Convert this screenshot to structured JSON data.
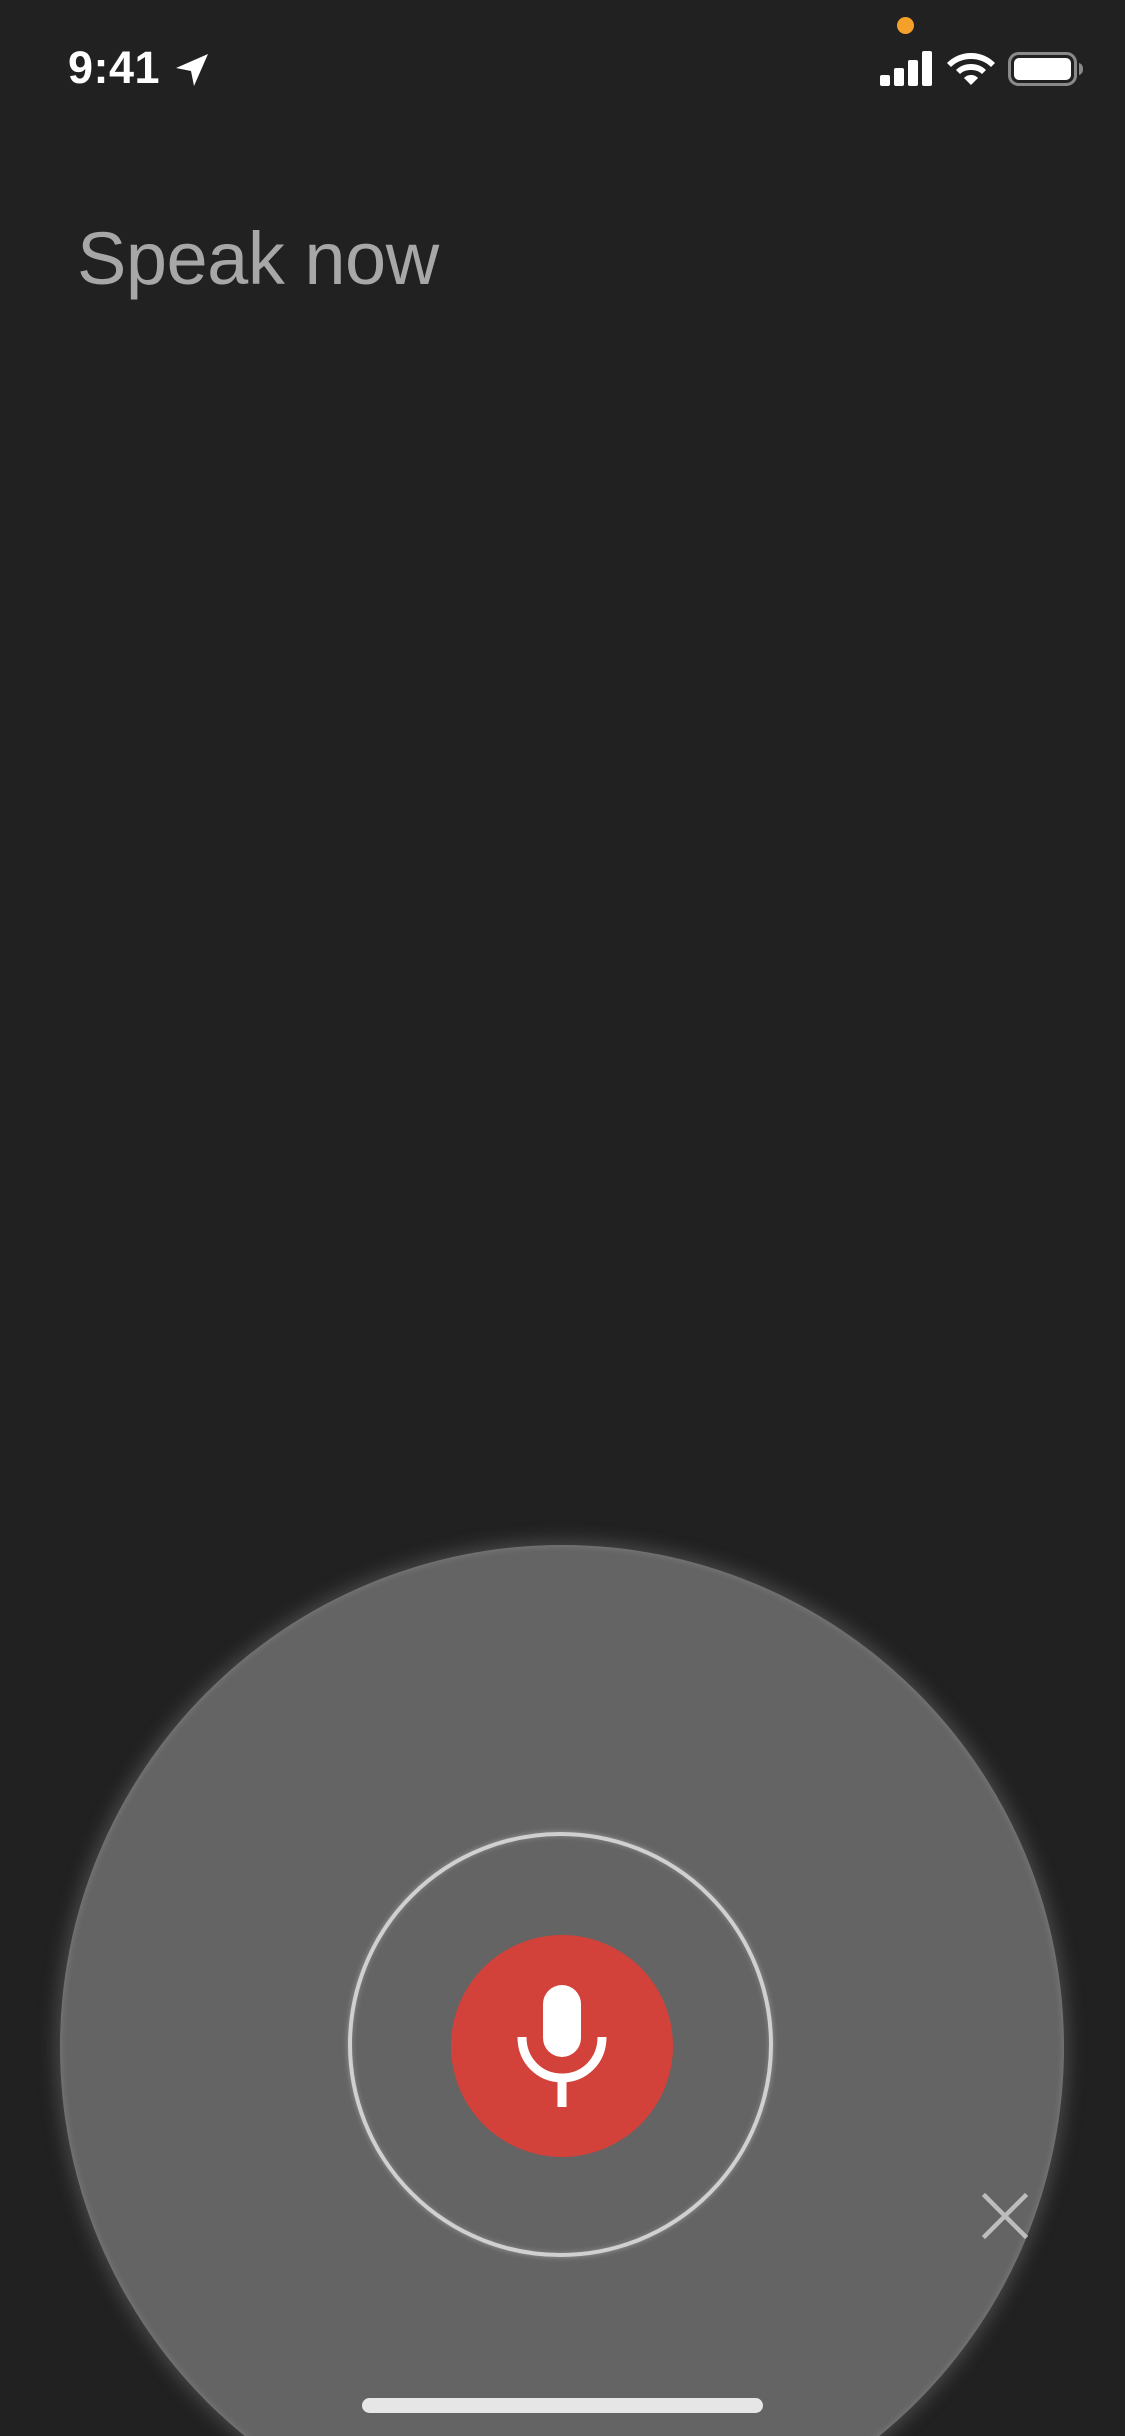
{
  "status_bar": {
    "time": "9:41",
    "icons": [
      "location-arrow-icon",
      "cellular-signal-icon",
      "wifi-icon",
      "battery-icon"
    ]
  },
  "voice_search": {
    "prompt": "Speak now",
    "mic_icon": "microphone-icon",
    "close_icon": "close-icon"
  },
  "colors": {
    "background": "#212121",
    "prompt_text": "#a7a7a7",
    "outer_circle": "#646464",
    "mic_button": "#d2413a",
    "privacy_dot": "#f6a02c",
    "close_icon": "#bdbdbd",
    "status_text": "#ffffff"
  }
}
